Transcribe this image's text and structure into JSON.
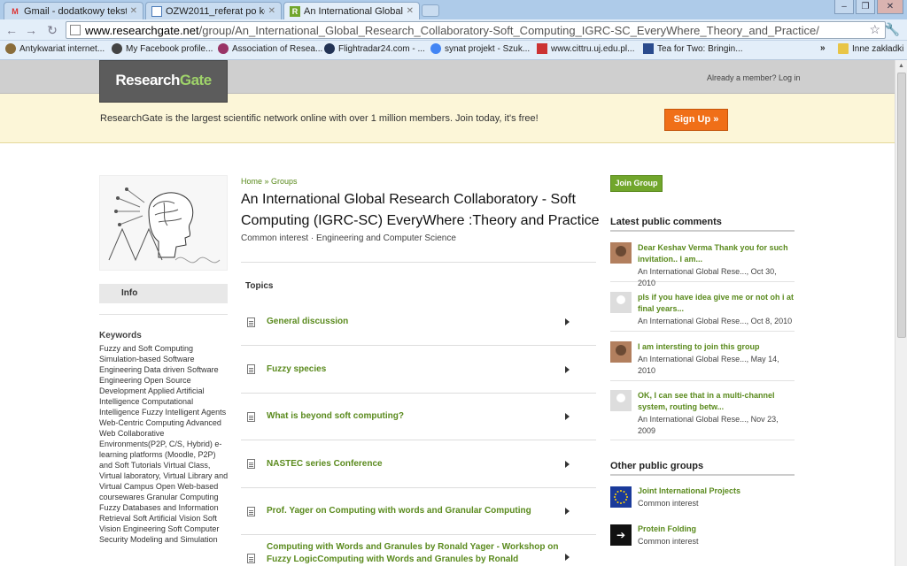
{
  "browser": {
    "tabs": [
      {
        "label": "Gmail - dodatkowy tekst - I",
        "icon": "gmail-icon"
      },
      {
        "label": "OZW2011_referat po korekc",
        "icon": "document-icon"
      },
      {
        "label": "An International Global Res",
        "icon": "researchgate-icon"
      }
    ],
    "url_host": "www.researchgate.net",
    "url_path": "/group/An_International_Global_Research_Collaboratory-Soft_Computing_IGRC-SC_EveryWhere_Theory_and_Practice/",
    "bookmarks": [
      {
        "label": "Antykwariat internet...",
        "color": "#8a6d3b"
      },
      {
        "label": "My Facebook profile...",
        "color": "#444444"
      },
      {
        "label": "Association of Resea...",
        "color": "#993366"
      },
      {
        "label": "Flightradar24.com - ...",
        "color": "#223355"
      },
      {
        "label": "synat projekt - Szuk...",
        "color": "#4285f4"
      },
      {
        "label": "www.cittru.uj.edu.pl...",
        "color": "#cc3333"
      },
      {
        "label": "Tea for Two: Bringin...",
        "color": "#2a4b8d"
      }
    ],
    "bookmarks_overflow": "»",
    "other_bookmarks": "Inne zakładki"
  },
  "header": {
    "logo_research": "Research",
    "logo_gate": "Gate",
    "member_link": "Already a member? Log in"
  },
  "banner": {
    "text": "ResearchGate is the largest scientific network online with over 1 million members. Join today, it's free!",
    "signup_label": "Sign Up »"
  },
  "left": {
    "info_tab": "Info",
    "keywords_title": "Keywords",
    "keywords": "Fuzzy and Soft Computing Simulation-based Software Engineering Data driven Software Engineering Open Source Development Applied Artificial Intelligence Computational Intelligence Fuzzy Intelligent Agents Web-Centric Computing Advanced Web Collaborative Environments(P2P, C/S, Hybrid) e-learning platforms (Moodle, P2P) and Soft Tutorials Virtual Class, Virtual laboratory, Virtual Library and Virtual Campus Open Web-based coursewares Granular Computing Fuzzy Databases and Information Retrieval Soft Artificial Vision Soft Vision Engineering Soft Computer Security Modeling and Simulation"
  },
  "main": {
    "breadcrumb": "Home » Groups",
    "title": "An International Global Research Collaboratory - Soft Computing (IGRC-SC) EveryWhere :Theory and Practice",
    "subtitle": "Common interest · Engineering and Computer Science",
    "topics_title": "Topics",
    "topics": [
      {
        "label": "General discussion"
      },
      {
        "label": "Fuzzy species"
      },
      {
        "label": "What is beyond soft computing?"
      },
      {
        "label": "NASTEC series Conference"
      },
      {
        "label": "Prof. Yager on Computing with words and Granular Computing"
      },
      {
        "label": "Computing with Words and Granules by Ronald Yager - Workshop on Fuzzy LogicComputing with Words and Granules by Ronald"
      }
    ]
  },
  "right": {
    "join_label": "Join Group",
    "comments_title": "Latest public comments",
    "comments": [
      {
        "text": "Dear Keshav Verma Thank you for such invitation.. I am...",
        "meta": "An International Global Rese..., Oct 30, 2010",
        "avatar": "photo"
      },
      {
        "text": "pls if you have idea give me or not oh i at final years...",
        "meta": "An International Global Rese..., Oct 8, 2010",
        "avatar": "blank"
      },
      {
        "text": "I am intersting to join this group",
        "meta": "An International Global Rese..., May 14, 2010",
        "avatar": "photo"
      },
      {
        "text": "OK, I can see that in a multi-channel system, routing betw...",
        "meta": "An International Global Rese..., Nov 23, 2009",
        "avatar": "blank"
      }
    ],
    "groups_title": "Other public groups",
    "groups": [
      {
        "name": "Joint International Projects",
        "sub": "Common interest",
        "icon": "eu-flag-icon"
      },
      {
        "name": "Protein Folding",
        "sub": "Common interest",
        "icon": "arrow-icon"
      }
    ]
  },
  "colors": {
    "accent_green": "#5a8a1d",
    "signup_orange": "#f06f18",
    "banner_bg": "#fcf6d8"
  }
}
